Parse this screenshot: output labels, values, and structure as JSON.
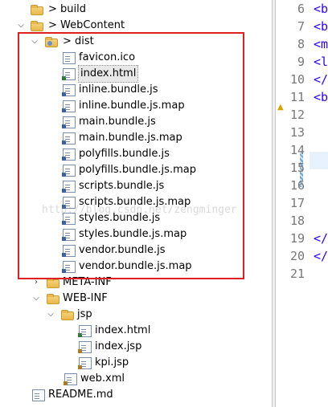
{
  "tree": {
    "build": "build",
    "web_content": "WebContent",
    "dist": "dist",
    "dist_files": [
      "favicon.ico",
      "index.html",
      "inline.bundle.js",
      "inline.bundle.js.map",
      "main.bundle.js",
      "main.bundle.js.map",
      "polyfills.bundle.js",
      "polyfills.bundle.js.map",
      "scripts.bundle.js",
      "scripts.bundle.js.map",
      "styles.bundle.js",
      "styles.bundle.js.map",
      "vendor.bundle.js",
      "vendor.bundle.js.map"
    ],
    "meta_inf": "META-INF",
    "web_inf": "WEB-INF",
    "jsp": "jsp",
    "jsp_files": [
      "index.html",
      "index.jsp",
      "kpi.jsp"
    ],
    "web_xml": "web.xml",
    "readme": "README.md",
    "selected_file": "index.html",
    "prefix_marker": ">"
  },
  "editor": {
    "line_numbers": [
      "6",
      "7",
      "8",
      "9",
      "10",
      "11",
      "12",
      "13",
      "14",
      "15",
      "16",
      "17",
      "18",
      "19",
      "20",
      "21"
    ],
    "code_fragments": {
      "6": "<b",
      "7": "<b",
      "8": "<m",
      "9": "<l",
      "10": "</",
      "11": "<b",
      "19": "</",
      "20": "</"
    }
  },
  "watermark": "http://blog.csdn.net/zengminger",
  "colors": {
    "highlight_box": "#e02020",
    "folder": "#e8b84a",
    "line_number": "#787878",
    "code": "#2a00ff"
  }
}
